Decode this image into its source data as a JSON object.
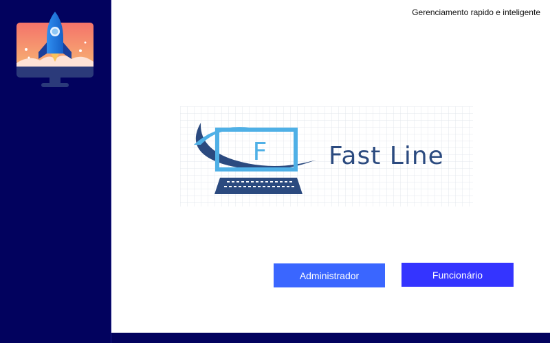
{
  "header": {
    "tagline": "Gerenciamento rapido e inteligente"
  },
  "sidebar": {
    "logo_icon": "rocket-monitor-icon"
  },
  "brand": {
    "name": "Fast Line",
    "letter": "F",
    "logo_icon": "computer-swoosh-logo-icon"
  },
  "actions": {
    "admin_label": "Administrador",
    "employee_label": "Funcionário"
  },
  "colors": {
    "sidebar": "#02025e",
    "admin_button": "#3a66ff",
    "employee_button": "#3434ff",
    "brand_text": "#2b4a7f",
    "brand_accent": "#4fb0e6"
  }
}
